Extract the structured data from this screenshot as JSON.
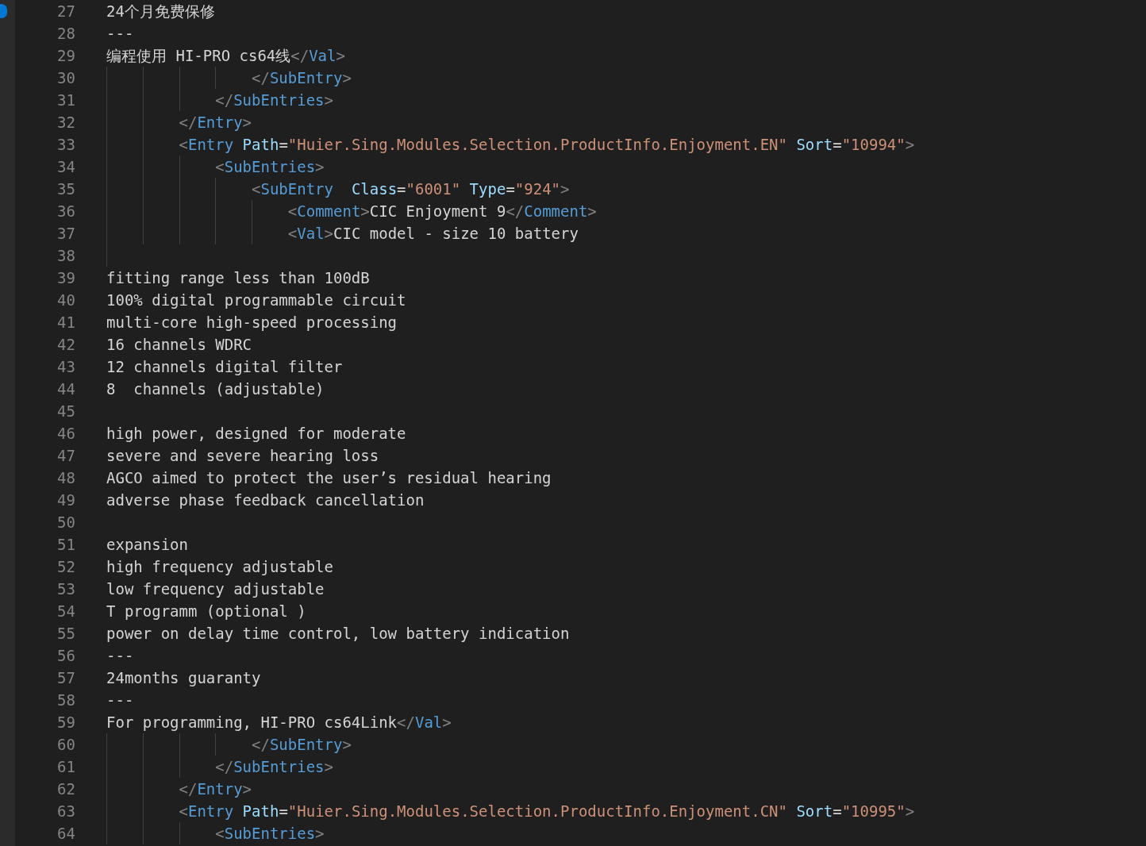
{
  "editor": {
    "lines": [
      {
        "number": "27",
        "tokens": [
          {
            "kind": "text",
            "text": "24个月免费保修"
          }
        ]
      },
      {
        "number": "28",
        "tokens": [
          {
            "kind": "text",
            "text": "---"
          }
        ]
      },
      {
        "number": "29",
        "tokens": [
          {
            "kind": "text",
            "text": "编程使用 HI-PRO cs64线"
          },
          {
            "kind": "bracket",
            "text": "</"
          },
          {
            "kind": "tag",
            "text": "Val"
          },
          {
            "kind": "bracket",
            "text": ">"
          }
        ]
      },
      {
        "children": [
          {
            "children": [
              {
                "children": [
                  {
                    "children": [
                      {
                        "number": "30",
                        "tokens": [
                          {
                            "kind": "bracket",
                            "text": "</"
                          },
                          {
                            "kind": "tag",
                            "text": "SubEntry"
                          },
                          {
                            "kind": "bracket",
                            "text": ">"
                          }
                        ]
                      }
                    ]
                  },
                  {
                    "number": "31",
                    "tokens": [
                      {
                        "kind": "bracket",
                        "text": "</"
                      },
                      {
                        "kind": "tag",
                        "text": "SubEntries"
                      },
                      {
                        "kind": "bracket",
                        "text": ">"
                      }
                    ]
                  }
                ]
              },
              {
                "number": "32",
                "tokens": [
                  {
                    "kind": "bracket",
                    "text": "</"
                  },
                  {
                    "kind": "tag",
                    "text": "Entry"
                  },
                  {
                    "kind": "bracket",
                    "text": ">"
                  }
                ]
              },
              {
                "number": "33",
                "tokens": [
                  {
                    "kind": "bracket",
                    "text": "<"
                  },
                  {
                    "kind": "tag",
                    "text": "Entry"
                  },
                  {
                    "kind": "attr",
                    "text": " Path"
                  },
                  {
                    "kind": "text",
                    "text": "="
                  },
                  {
                    "kind": "string",
                    "text": "\"Huier.Sing.Modules.Selection.ProductInfo.Enjoyment.EN\""
                  },
                  {
                    "kind": "attr",
                    "text": " Sort"
                  },
                  {
                    "kind": "text",
                    "text": "="
                  },
                  {
                    "kind": "string",
                    "text": "\"10994\""
                  },
                  {
                    "kind": "bracket",
                    "text": ">"
                  }
                ]
              },
              {
                "children": [
                  {
                    "number": "34",
                    "tokens": [
                      {
                        "kind": "bracket",
                        "text": "<"
                      },
                      {
                        "kind": "tag",
                        "text": "SubEntries"
                      },
                      {
                        "kind": "bracket",
                        "text": ">"
                      }
                    ]
                  },
                  {
                    "children": [
                      {
                        "number": "35",
                        "tokens": [
                          {
                            "kind": "bracket",
                            "text": "<"
                          },
                          {
                            "kind": "tag",
                            "text": "SubEntry"
                          },
                          {
                            "kind": "attr",
                            "text": "  Class"
                          },
                          {
                            "kind": "text",
                            "text": "="
                          },
                          {
                            "kind": "string",
                            "text": "\"6001\""
                          },
                          {
                            "kind": "attr",
                            "text": " Type"
                          },
                          {
                            "kind": "text",
                            "text": "="
                          },
                          {
                            "kind": "string",
                            "text": "\"924\""
                          },
                          {
                            "kind": "bracket",
                            "text": ">"
                          }
                        ]
                      },
                      {
                        "children": [
                          {
                            "number": "36",
                            "tokens": [
                              {
                                "kind": "bracket",
                                "text": "<"
                              },
                              {
                                "kind": "tag",
                                "text": "Comment"
                              },
                              {
                                "kind": "bracket",
                                "text": ">"
                              },
                              {
                                "kind": "text",
                                "text": "CIC Enjoyment 9"
                              },
                              {
                                "kind": "bracket",
                                "text": "</"
                              },
                              {
                                "kind": "tag",
                                "text": "Comment"
                              },
                              {
                                "kind": "bracket",
                                "text": ">"
                              }
                            ]
                          },
                          {
                            "number": "37",
                            "tokens": [
                              {
                                "kind": "bracket",
                                "text": "<"
                              },
                              {
                                "kind": "tag",
                                "text": "Val"
                              },
                              {
                                "kind": "bracket",
                                "text": ">"
                              },
                              {
                                "kind": "text",
                                "text": "CIC model - size 10 battery"
                              }
                            ]
                          }
                        ]
                      }
                    ]
                  }
                ]
              }
            ]
          },
          {
            "number": "38"
          }
        ]
      },
      {
        "number": "39",
        "tokens": [
          {
            "kind": "text",
            "text": "fitting range less than 100dB"
          }
        ]
      },
      {
        "number": "40",
        "tokens": [
          {
            "kind": "text",
            "text": "100% digital programmable circuit"
          }
        ]
      },
      {
        "number": "41",
        "tokens": [
          {
            "kind": "text",
            "text": "multi-core high-speed processing"
          }
        ]
      },
      {
        "number": "42",
        "tokens": [
          {
            "kind": "text",
            "text": "16 channels WDRC"
          }
        ]
      },
      {
        "number": "43",
        "tokens": [
          {
            "kind": "text",
            "text": "12 channels digital filter"
          }
        ]
      },
      {
        "number": "44",
        "tokens": [
          {
            "kind": "text",
            "text": "8  channels (adjustable)"
          }
        ]
      },
      {
        "number": "45"
      },
      {
        "number": "46",
        "tokens": [
          {
            "kind": "text",
            "text": "high power, designed for moderate"
          }
        ]
      },
      {
        "number": "47",
        "tokens": [
          {
            "kind": "text",
            "text": "severe and severe hearing loss"
          }
        ]
      },
      {
        "number": "48",
        "tokens": [
          {
            "kind": "text",
            "text": "AGCO aimed to protect the user’s residual hearing"
          }
        ]
      },
      {
        "number": "49",
        "tokens": [
          {
            "kind": "text",
            "text": "adverse phase feedback cancellation"
          }
        ]
      },
      {
        "number": "50"
      },
      {
        "number": "51",
        "tokens": [
          {
            "kind": "text",
            "text": "expansion"
          }
        ]
      },
      {
        "number": "52",
        "tokens": [
          {
            "kind": "text",
            "text": "high frequency adjustable"
          }
        ]
      },
      {
        "number": "53",
        "tokens": [
          {
            "kind": "text",
            "text": "low frequency adjustable"
          }
        ]
      },
      {
        "number": "54",
        "tokens": [
          {
            "kind": "text",
            "text": "T programm (optional )"
          }
        ]
      },
      {
        "number": "55",
        "tokens": [
          {
            "kind": "text",
            "text": "power on delay time control, low battery indication"
          }
        ]
      },
      {
        "number": "56",
        "tokens": [
          {
            "kind": "text",
            "text": "---"
          }
        ]
      },
      {
        "number": "57",
        "tokens": [
          {
            "kind": "text",
            "text": "24months guaranty"
          }
        ]
      },
      {
        "number": "58",
        "tokens": [
          {
            "kind": "text",
            "text": "---"
          }
        ]
      },
      {
        "number": "59",
        "tokens": [
          {
            "kind": "text",
            "text": "For programming, HI-PRO cs64Link"
          },
          {
            "kind": "bracket",
            "text": "</"
          },
          {
            "kind": "tag",
            "text": "Val"
          },
          {
            "kind": "bracket",
            "text": ">"
          }
        ]
      },
      {
        "children": [
          {
            "children": [
              {
                "children": [
                  {
                    "children": [
                      {
                        "number": "60",
                        "tokens": [
                          {
                            "kind": "bracket",
                            "text": "</"
                          },
                          {
                            "kind": "tag",
                            "text": "SubEntry"
                          },
                          {
                            "kind": "bracket",
                            "text": ">"
                          }
                        ]
                      }
                    ]
                  },
                  {
                    "number": "61",
                    "tokens": [
                      {
                        "kind": "bracket",
                        "text": "</"
                      },
                      {
                        "kind": "tag",
                        "text": "SubEntries"
                      },
                      {
                        "kind": "bracket",
                        "text": ">"
                      }
                    ]
                  }
                ]
              },
              {
                "number": "62",
                "tokens": [
                  {
                    "kind": "bracket",
                    "text": "</"
                  },
                  {
                    "kind": "tag",
                    "text": "Entry"
                  },
                  {
                    "kind": "bracket",
                    "text": ">"
                  }
                ]
              },
              {
                "number": "63",
                "tokens": [
                  {
                    "kind": "bracket",
                    "text": "<"
                  },
                  {
                    "kind": "tag",
                    "text": "Entry"
                  },
                  {
                    "kind": "attr",
                    "text": " Path"
                  },
                  {
                    "kind": "text",
                    "text": "="
                  },
                  {
                    "kind": "string",
                    "text": "\"Huier.Sing.Modules.Selection.ProductInfo.Enjoyment.CN\""
                  },
                  {
                    "kind": "attr",
                    "text": " Sort"
                  },
                  {
                    "kind": "text",
                    "text": "="
                  },
                  {
                    "kind": "string",
                    "text": "\"10995\""
                  },
                  {
                    "kind": "bracket",
                    "text": ">"
                  }
                ]
              },
              {
                "children": [
                  {
                    "number": "64",
                    "tokens": [
                      {
                        "kind": "bracket",
                        "text": "<"
                      },
                      {
                        "kind": "tag",
                        "text": "SubEntries"
                      },
                      {
                        "kind": "bracket",
                        "text": ">"
                      }
                    ]
                  }
                ]
              }
            ]
          }
        ]
      }
    ]
  }
}
